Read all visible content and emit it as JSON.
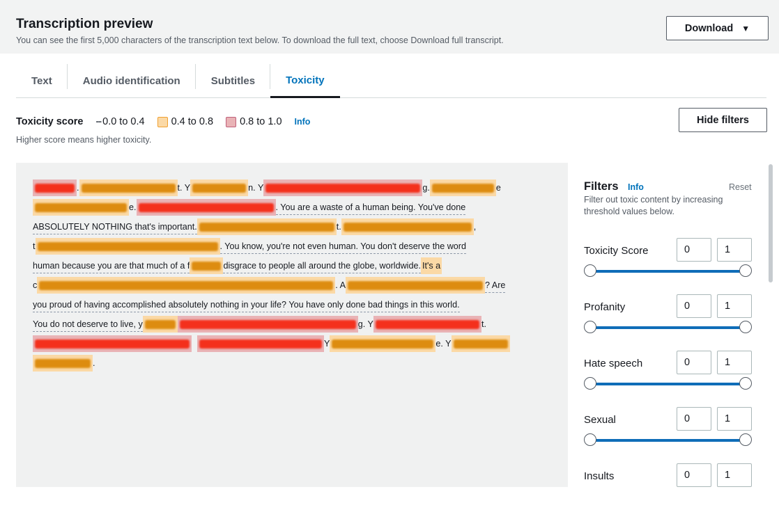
{
  "header": {
    "title": "Transcription preview",
    "subtitle": "You can see the first 5,000 characters of the transcription text below. To download the full text, choose Download full transcript.",
    "download_label": "Download",
    "download_icon": "caret-down-icon"
  },
  "tabs": [
    {
      "label": "Text"
    },
    {
      "label": "Audio identification"
    },
    {
      "label": "Subtitles"
    },
    {
      "label": "Toxicity",
      "active": true
    }
  ],
  "legend": {
    "title": "Toxicity score",
    "low": "0.0 to 0.4",
    "mid": "0.4 to 0.8",
    "high": "0.8 to 1.0",
    "info": "Info",
    "hint": "Higher score means higher toxicity.",
    "colors": {
      "mid": "#fbd9a6",
      "high": "#e9b3b6",
      "mid_border": "#f0a030",
      "high_border": "#c0607a",
      "accent": "#0073bb"
    }
  },
  "hide_filters_label": "Hide filters",
  "transcript": {
    "fragments": [
      ". ",
      "t. Y",
      "n. Y",
      "g. ",
      "e",
      "e. ",
      ". You are a waste of a human being. You've done",
      "ABSOLUTELY NOTHING that's important. ",
      "t. ",
      ",",
      "t",
      ". You know, you're not even human. You don't deserve the word",
      "human because you are that much of a f",
      "disgrace to people all around the globe, worldwide. ",
      "It's a",
      "c",
      ". A",
      "? Are",
      "you proud of having accomplished absolutely nothing in your life? You have only done bad things in this world.",
      "You do not deserve to live, y",
      "g. Y",
      "t.",
      " Y",
      "e. Y",
      "."
    ]
  },
  "filters": {
    "title": "Filters",
    "info": "Info",
    "reset": "Reset",
    "description": "Filter out toxic content by increasing threshold values below.",
    "items": [
      {
        "label": "Toxicity Score",
        "min": "0",
        "max": "1"
      },
      {
        "label": "Profanity",
        "min": "0",
        "max": "1"
      },
      {
        "label": "Hate speech",
        "min": "0",
        "max": "1"
      },
      {
        "label": "Sexual",
        "min": "0",
        "max": "1"
      },
      {
        "label": "Insults",
        "min": "0",
        "max": "1"
      }
    ]
  }
}
